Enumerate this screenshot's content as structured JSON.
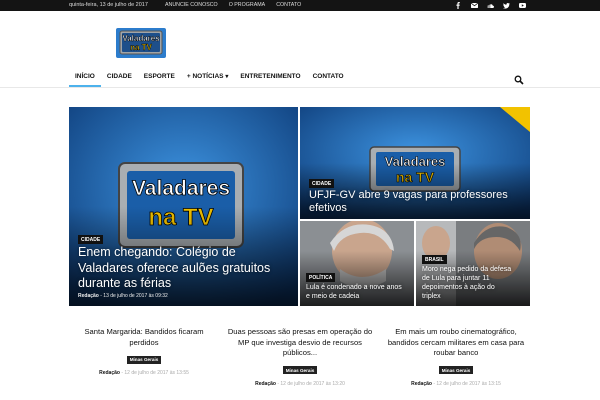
{
  "topbar": {
    "date": "quinta-feira, 13 de julho de 2017",
    "links": [
      "ANUNCIE CONOSCO",
      "O PROGRAMA",
      "CONTATO"
    ],
    "social_icons": [
      "facebook-icon",
      "mail-icon",
      "soundcloud-icon",
      "twitter-icon",
      "youtube-icon"
    ]
  },
  "logo": {
    "line1": "Valadares",
    "line2": "na TV"
  },
  "nav": {
    "items": [
      "INÍCIO",
      "CIDADE",
      "ESPORTE",
      "+ NOTÍCIAS",
      "ENTRETENIMENTO",
      "CONTATO"
    ],
    "active": "INÍCIO",
    "accent": "#4db2ec"
  },
  "tiles": {
    "main": {
      "category": "CIDADE",
      "title": "Enem chegando: Colégio de Valadares oferece aulões gratuitos durante as férias",
      "author": "Redação",
      "date": "13 de julho de 2017 às 09:32"
    },
    "top_right": {
      "category": "CIDADE",
      "title": "UFJF-GV abre 9 vagas para professores efetivos"
    },
    "bottom_left": {
      "category": "POLÍTICA",
      "title": "Lula é condenado a nove anos e meio de cadeia"
    },
    "bottom_right": {
      "category": "BRASIL",
      "title": "Moro nega pedido da defesa de Lula para juntar 11 depoimentos à ação do triplex"
    }
  },
  "articles": [
    {
      "title": "Santa Margarida: Bandidos ficaram perdidos",
      "category": "Minas Gerais",
      "author": "Redação",
      "date": "12 de julho de 2017 às 13:55"
    },
    {
      "title": "Duas pessoas são presas em operação do MP que investiga desvio de recursos públicos...",
      "category": "Minas Gerais",
      "author": "Redação",
      "date": "12 de julho de 2017 às 13:20"
    },
    {
      "title": "Em mais um roubo cinematográfico, bandidos cercam militares em casa para roubar banco",
      "category": "Minas Gerais",
      "author": "Redação",
      "date": "12 de julho de 2017 às 13:15"
    }
  ]
}
